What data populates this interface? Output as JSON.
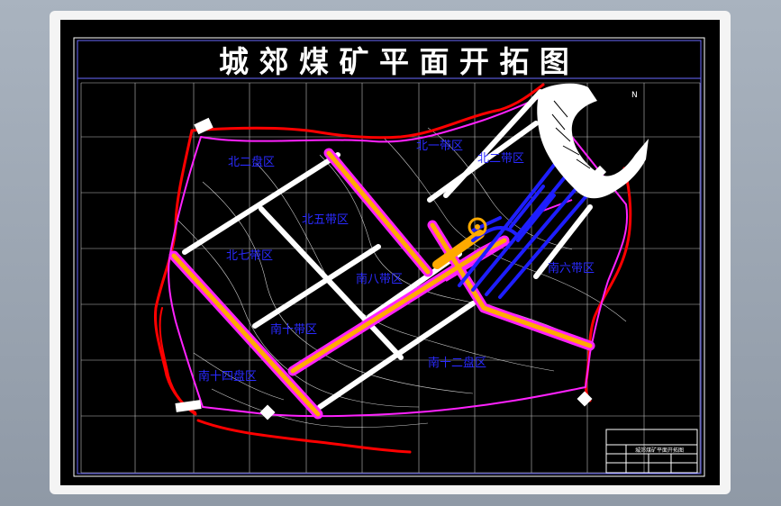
{
  "drawing": {
    "title": "城 郊 煤 矿 平 面 开 拓 图",
    "north_mark": "N",
    "zones": [
      {
        "name": "北二盘区"
      },
      {
        "name": "北一带区"
      },
      {
        "name": "北二带区"
      },
      {
        "name": "北五带区"
      },
      {
        "name": "北七带区"
      },
      {
        "name": "南八带区"
      },
      {
        "name": "南六带区"
      },
      {
        "name": "南十带区"
      },
      {
        "name": "南十二盘区"
      },
      {
        "name": "南十四盘区"
      }
    ],
    "title_block": {
      "caption": "城郊煤矿平面开拓图"
    },
    "colors": {
      "background": "#000000",
      "frame": "#f4f4f4",
      "grid": "#ffffff",
      "mining_boundary": "#ff22ff",
      "fault_line": "#ff0000",
      "roadway": "#ffffff",
      "main_roadway": "#ffaa00",
      "label": "#2a2aff"
    }
  }
}
